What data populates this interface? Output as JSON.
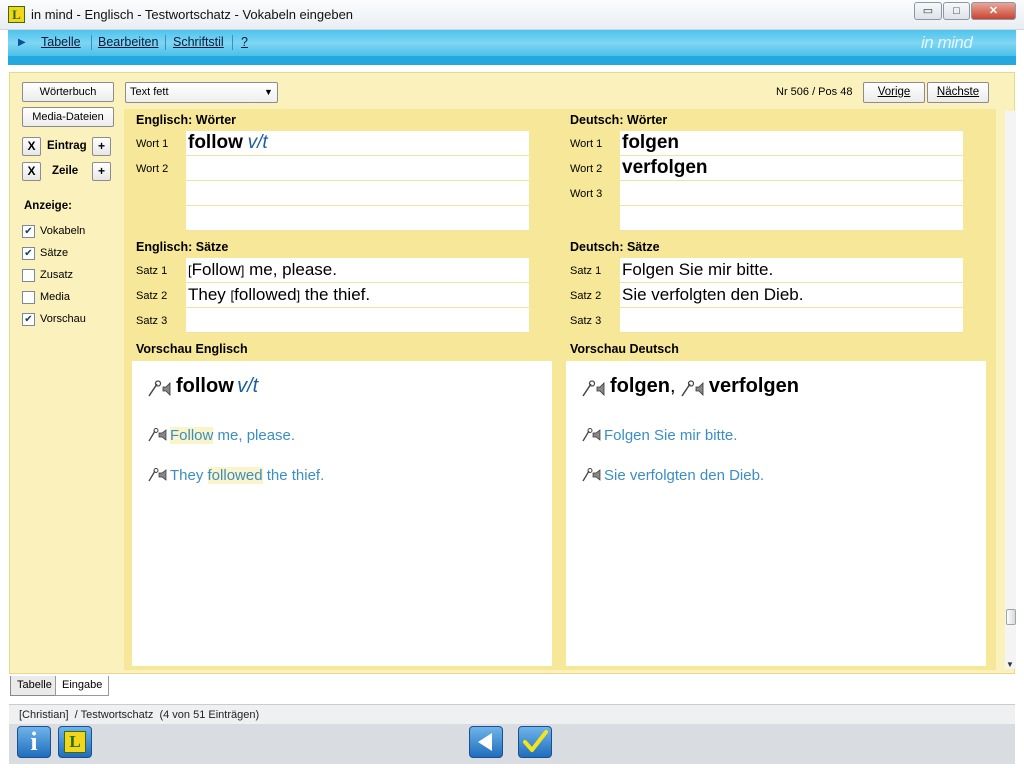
{
  "window": {
    "title": "in mind - Englisch - Testwortschatz - Vokabeln eingeben",
    "app_icon_letter": "L",
    "minimize": "▭",
    "maximize": "□",
    "close": "✕"
  },
  "menu": {
    "items": [
      "Tabelle",
      "Bearbeiten",
      "Schriftstil",
      "?"
    ],
    "logo": "in mind"
  },
  "sidebar": {
    "woerterbuch": "Wörterbuch",
    "media": "Media-Dateien",
    "entry_remove": "X",
    "entry_label": "Eintrag",
    "entry_add": "+",
    "line_remove": "X",
    "line_label": "Zeile",
    "line_add": "+",
    "display_label": "Anzeige:",
    "options": [
      {
        "label": "Vokabeln",
        "checked": true
      },
      {
        "label": "Sätze",
        "checked": true
      },
      {
        "label": "Zusatz",
        "checked": false
      },
      {
        "label": "Media",
        "checked": false
      },
      {
        "label": "Vorschau",
        "checked": true
      }
    ]
  },
  "toolbar": {
    "style_select": "Text fett",
    "position": "Nr 506 / Pos 48",
    "prev": "Vorige",
    "next": "Nächste"
  },
  "english": {
    "words_title": "Englisch: Wörter",
    "word_labels": [
      "Wort 1",
      "Wort 2"
    ],
    "word1_main": "follow",
    "word1_suffix": "v/t",
    "sentences_title": "Englisch: Sätze",
    "sentence_labels": [
      "Satz 1",
      "Satz 2",
      "Satz 3"
    ],
    "s1_open": "[",
    "s1_word": "Follow",
    "s1_close": "]",
    "s1_rest": " me, please.",
    "s2_pre": "They ",
    "s2_open": "[",
    "s2_word": "followed",
    "s2_close": "]",
    "s2_rest": " the thief.",
    "preview_title": "Vorschau Englisch",
    "pv_word": "follow",
    "pv_suffix": "v/t",
    "pv_s1_hl": "Follow",
    "pv_s1_rest": " me, please.",
    "pv_s2_pre": "They ",
    "pv_s2_hl": "followed",
    "pv_s2_rest": " the thief."
  },
  "german": {
    "words_title": "Deutsch: Wörter",
    "word_labels": [
      "Wort 1",
      "Wort 2",
      "Wort 3"
    ],
    "words": [
      "folgen",
      "verfolgen"
    ],
    "sentences_title": "Deutsch: Sätze",
    "sentence_labels": [
      "Satz 1",
      "Satz 2",
      "Satz 3"
    ],
    "sentences": [
      "Folgen Sie mir bitte.",
      "Sie verfolgten den Dieb."
    ],
    "preview_title": "Vorschau Deutsch",
    "pv_word1": "folgen",
    "pv_sep": ",",
    "pv_word2": "verfolgen",
    "pv_s1": "Folgen Sie mir bitte.",
    "pv_s2": "Sie verfolgten den Dieb."
  },
  "tabs": [
    "Tabelle",
    "Eingabe"
  ],
  "status": {
    "user": "[Christian]",
    "path": "/ Testwortschatz",
    "count": "(4 von 51 Einträgen)"
  },
  "bottom": {
    "info_icon": "i",
    "lexicon_icon": "L"
  },
  "colors": {
    "menu_blue": "#4fc3ec",
    "panel_yellow": "#f6e898",
    "preview_sentence": "#3a8ec3"
  }
}
